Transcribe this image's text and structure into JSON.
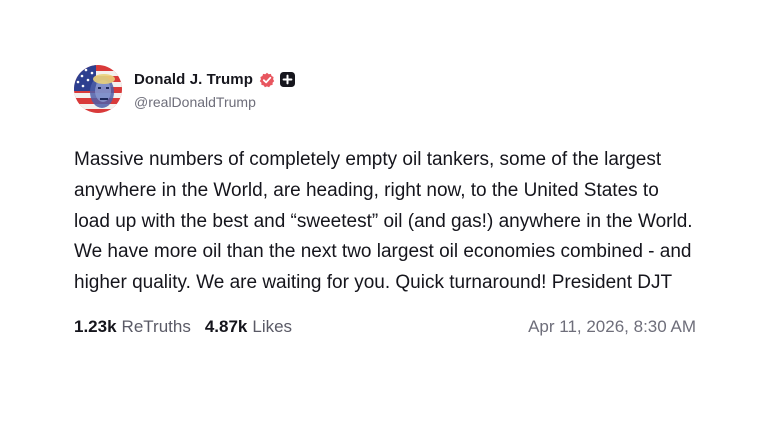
{
  "author": {
    "display_name": "Donald J. Trump",
    "handle": "@realDonaldTrump",
    "verified_icon": "verified-badge-icon",
    "plus_icon": "plus-badge-icon"
  },
  "post": {
    "text": "Massive numbers of completely empty oil tankers, some of the largest anywhere in the World, are heading, right now, to the United States to load up with the best and “sweetest” oil (and gas!) anywhere in the World. We have more oil than the next two largest oil economies combined - and higher quality. We are waiting for you. Quick turnaround! President DJT"
  },
  "stats": {
    "retruths_count": "1.23k",
    "retruths_label": "ReTruths",
    "likes_count": "4.87k",
    "likes_label": "Likes",
    "timestamp": "Apr 11, 2026, 8:30 AM"
  },
  "colors": {
    "verified": "#e8565f",
    "text": "#15151c",
    "muted": "#6e6e7a"
  }
}
